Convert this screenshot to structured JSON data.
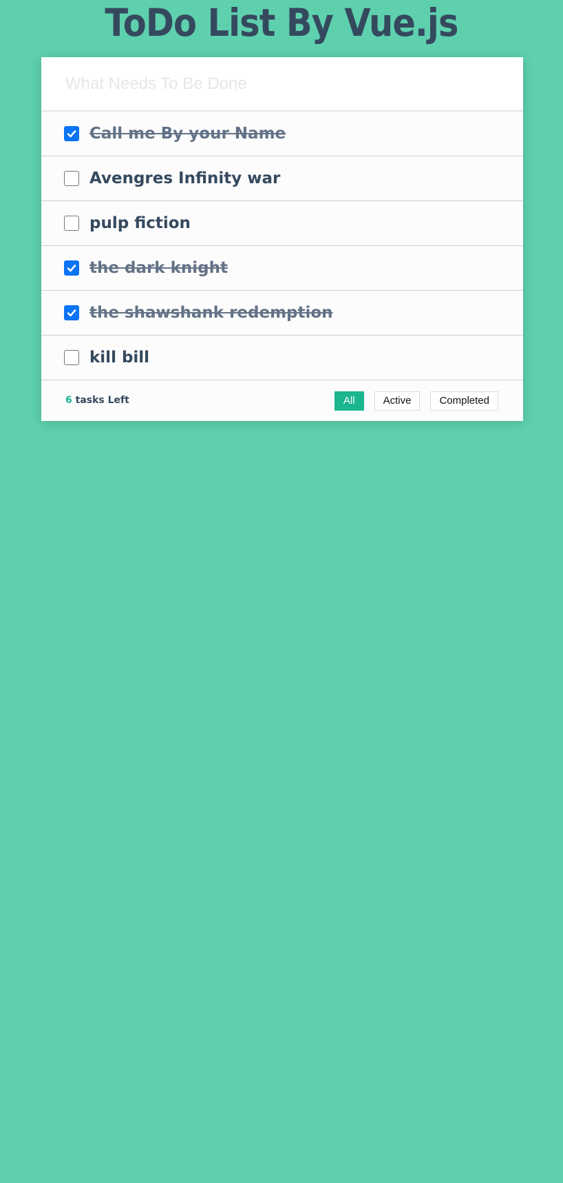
{
  "header": {
    "title": "ToDo List By Vue.js"
  },
  "new_todo": {
    "placeholder": "What Needs To Be Done",
    "value": ""
  },
  "todos": [
    {
      "label": "Call me By your Name",
      "completed": true
    },
    {
      "label": "Avengres Infinity war",
      "completed": false
    },
    {
      "label": "pulp fiction",
      "completed": false
    },
    {
      "label": "the dark knight",
      "completed": true
    },
    {
      "label": "the shawshank redemption",
      "completed": true
    },
    {
      "label": "kill bill",
      "completed": false
    }
  ],
  "footer": {
    "count": "6",
    "count_suffix": " tasks Left",
    "filters": [
      {
        "label": "All",
        "active": true
      },
      {
        "label": "Active",
        "active": false
      },
      {
        "label": "Completed",
        "active": false
      }
    ]
  },
  "colors": {
    "background": "#5ed0ae",
    "title": "#35495e",
    "accent": "#1bb58f",
    "checkbox_checked": "#0b74f4",
    "done_text": "#637286"
  }
}
